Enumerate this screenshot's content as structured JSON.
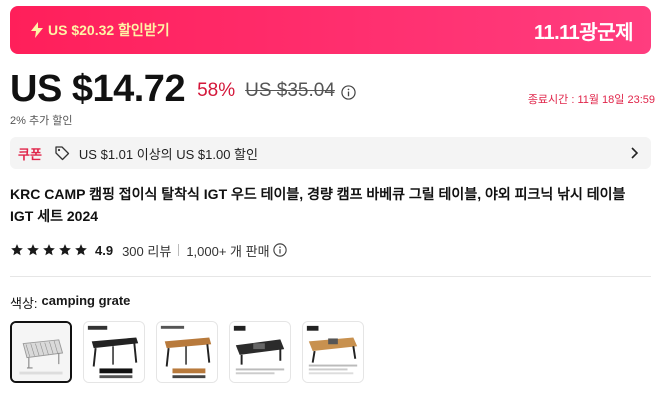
{
  "banner": {
    "coupon_text": "US $20.32 할인받기",
    "event_label": "11.11광군제"
  },
  "price": {
    "current": "US $14.72",
    "discount_percent": "58%",
    "original": "US $35.04",
    "deadline": "종료시간 : 11월 18일 23:59",
    "extra_discount": "2% 추가 할인"
  },
  "coupon": {
    "label": "쿠폰",
    "text": "US $1.01 이상의 US $1.00 할인"
  },
  "product": {
    "title": "KRC CAMP 캠핑 접이식 탈착식 IGT 우드 테이블, 경량 캠프 바베큐 그릴 테이블, 야외 피크닉 낚시 테이블 IGT 세트 2024",
    "rating": "4.9",
    "stars": 5,
    "reviews": "300 리뷰",
    "sold": "1,000+ 개 판매"
  },
  "variant": {
    "label": "색상:",
    "value": "camping grate",
    "thumbnails": [
      {
        "name": "camping grate",
        "selected": true
      },
      {
        "name": "black table",
        "selected": false
      },
      {
        "name": "wood table",
        "selected": false
      },
      {
        "name": "black IGT set",
        "selected": false
      },
      {
        "name": "wood IGT set",
        "selected": false
      }
    ]
  },
  "colors": {
    "accent": "#ff2a64",
    "discount_red": "#d4173a",
    "coupon_highlight": "#fff3a6"
  }
}
